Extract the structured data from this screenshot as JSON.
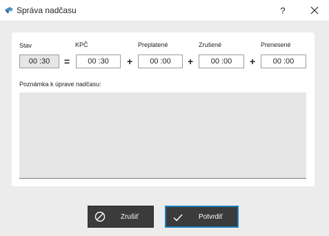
{
  "window": {
    "title": "Správa nadčasu",
    "help_label": "?"
  },
  "fields": {
    "stav": {
      "label": "Stav",
      "value": "00 :30"
    },
    "kpc": {
      "label": "KPČ",
      "value": "00 :30"
    },
    "preplatene": {
      "label": "Preplatené",
      "value": "00 :00"
    },
    "zrusene": {
      "label": "Zrušené",
      "value": "00 :00"
    },
    "prenesene": {
      "label": "Prenesené",
      "value": "00 :00"
    }
  },
  "operators": {
    "equals": "=",
    "plus": "+"
  },
  "note": {
    "label": "Poznámka k úprave nadčasu:",
    "value": ""
  },
  "buttons": {
    "cancel_label": "Zrušiť",
    "confirm_label": "Potvrdiť"
  },
  "colors": {
    "confirm_border": "#1d7fbf",
    "button_bg": "#3b3b3b",
    "readonly_bg": "#e6e6e6"
  },
  "icons": {
    "app": "app-logo-icon",
    "close": "close-icon",
    "cancel": "cancel-circle-icon",
    "confirm": "check-icon"
  }
}
